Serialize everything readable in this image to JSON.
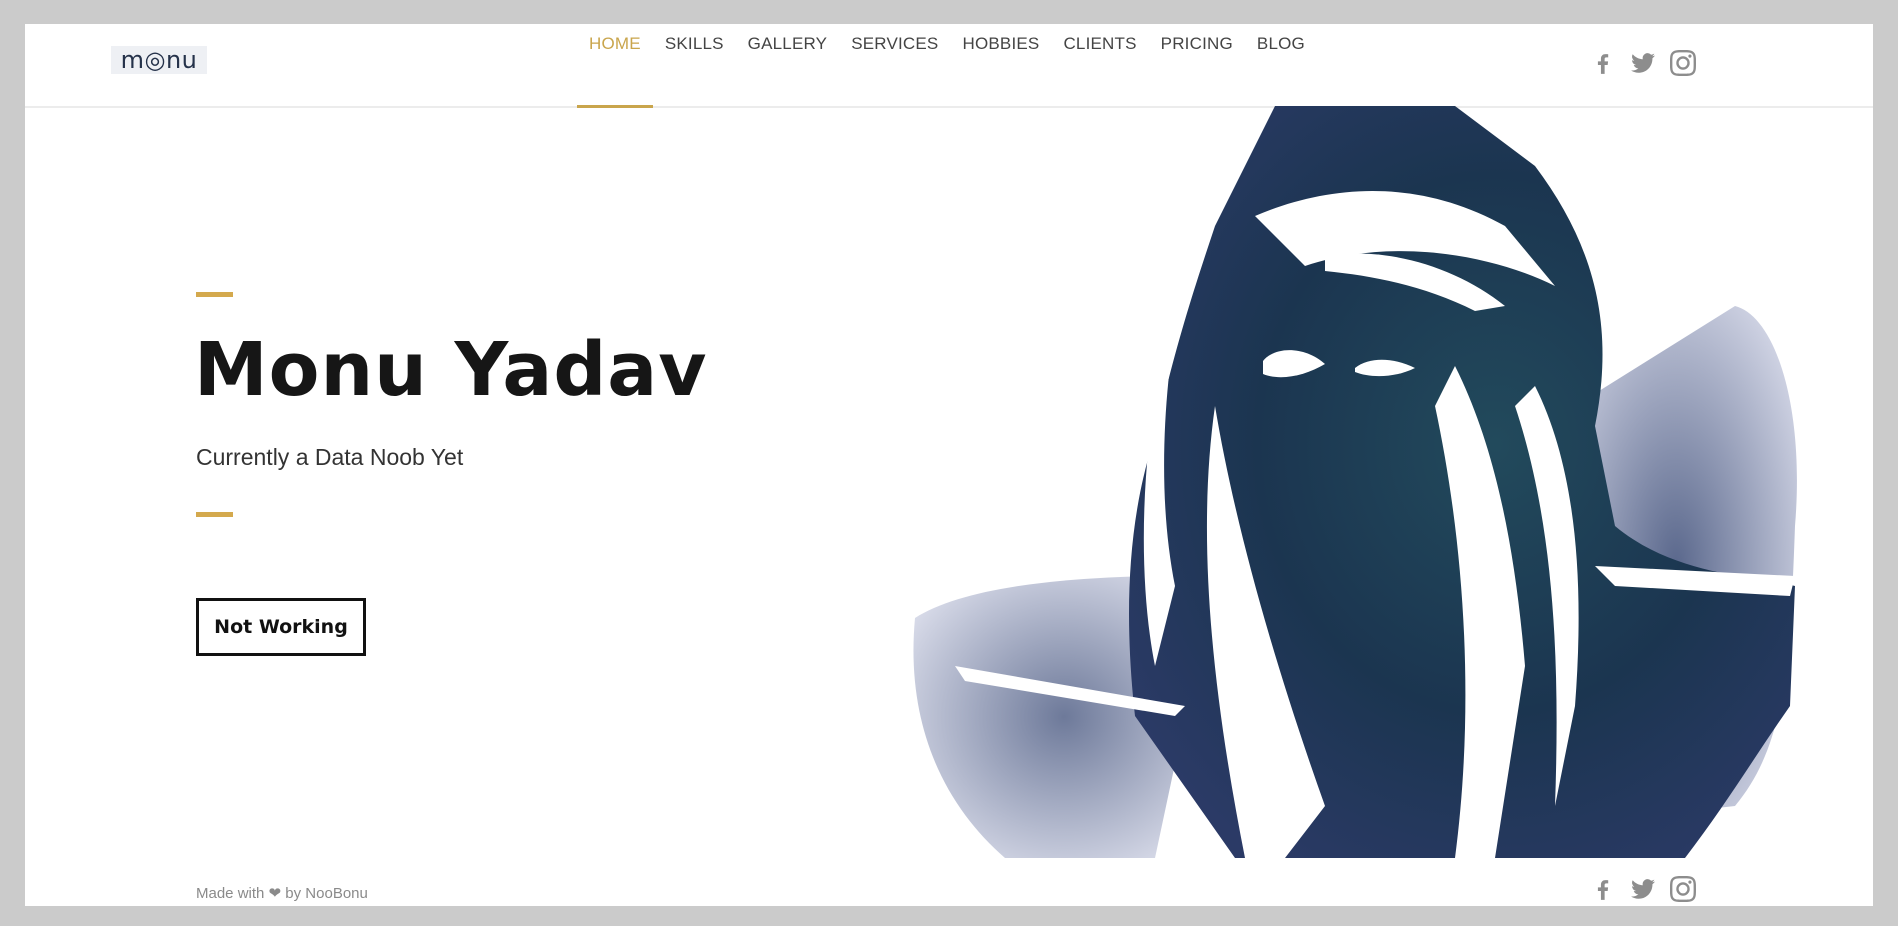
{
  "header": {
    "logo_text": "m◎nu",
    "nav": [
      {
        "label": "HOME",
        "active": true
      },
      {
        "label": "SKILLS",
        "active": false
      },
      {
        "label": "GALLERY",
        "active": false
      },
      {
        "label": "SERVICES",
        "active": false
      },
      {
        "label": "HOBBIES",
        "active": false
      },
      {
        "label": "CLIENTS",
        "active": false
      },
      {
        "label": "PRICING",
        "active": false
      },
      {
        "label": "BLOG",
        "active": false
      }
    ],
    "social_icons": [
      "facebook-icon",
      "twitter-icon",
      "instagram-icon"
    ]
  },
  "hero": {
    "title": "Monu Yadav",
    "subtitle": "Currently a Data Noob Yet",
    "button_label": "Not Working",
    "illustration": "hooded-figure-watercolor"
  },
  "footer": {
    "made_with": "Made with",
    "by_text": "by NooBonu",
    "heart_icon": "heart-icon",
    "social_icons": [
      "facebook-icon",
      "twitter-icon",
      "instagram-icon"
    ]
  },
  "colors": {
    "accent": "#c9a54c",
    "text_dark": "#161616",
    "nav_text": "#444444",
    "icon_gray": "#8d8d8d",
    "art_navy": "#1d3348",
    "page_background": "#cbcbcb"
  }
}
